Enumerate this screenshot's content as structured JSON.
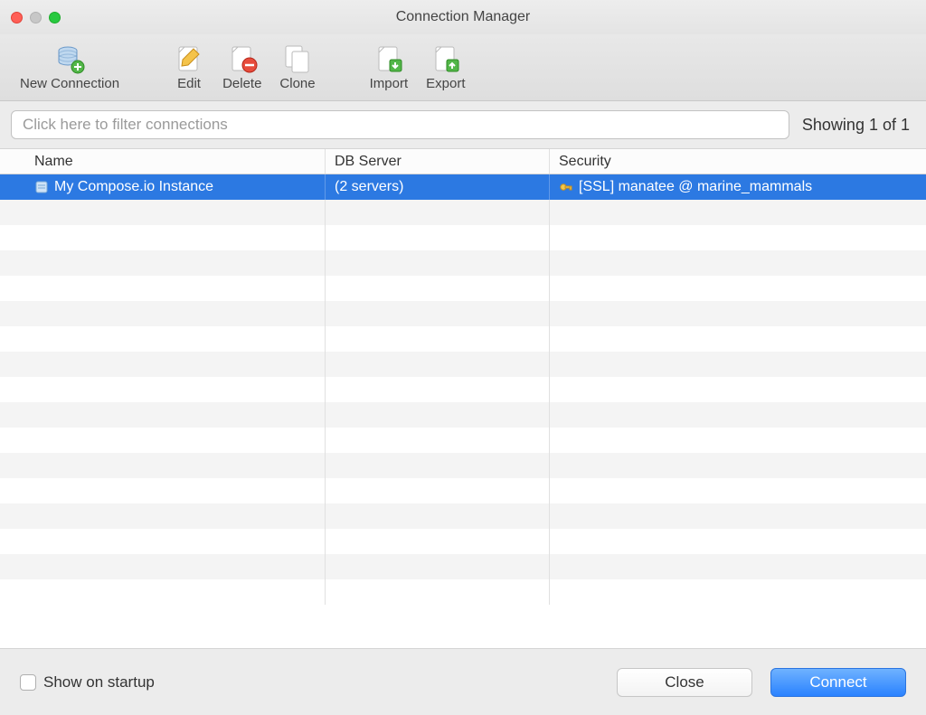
{
  "window": {
    "title": "Connection Manager"
  },
  "toolbar": {
    "new_connection": "New Connection",
    "edit": "Edit",
    "delete": "Delete",
    "clone": "Clone",
    "import": "Import",
    "export": "Export"
  },
  "filter": {
    "placeholder": "Click here to filter connections",
    "showing": "Showing 1 of 1"
  },
  "columns": {
    "name": "Name",
    "db_server": "DB Server",
    "security": "Security"
  },
  "rows": [
    {
      "name": "My Compose.io Instance",
      "db_server": "(2 servers)",
      "security": "[SSL] manatee @ marine_mammals",
      "selected": true
    }
  ],
  "footer": {
    "show_on_startup": "Show on startup",
    "close": "Close",
    "connect": "Connect"
  }
}
